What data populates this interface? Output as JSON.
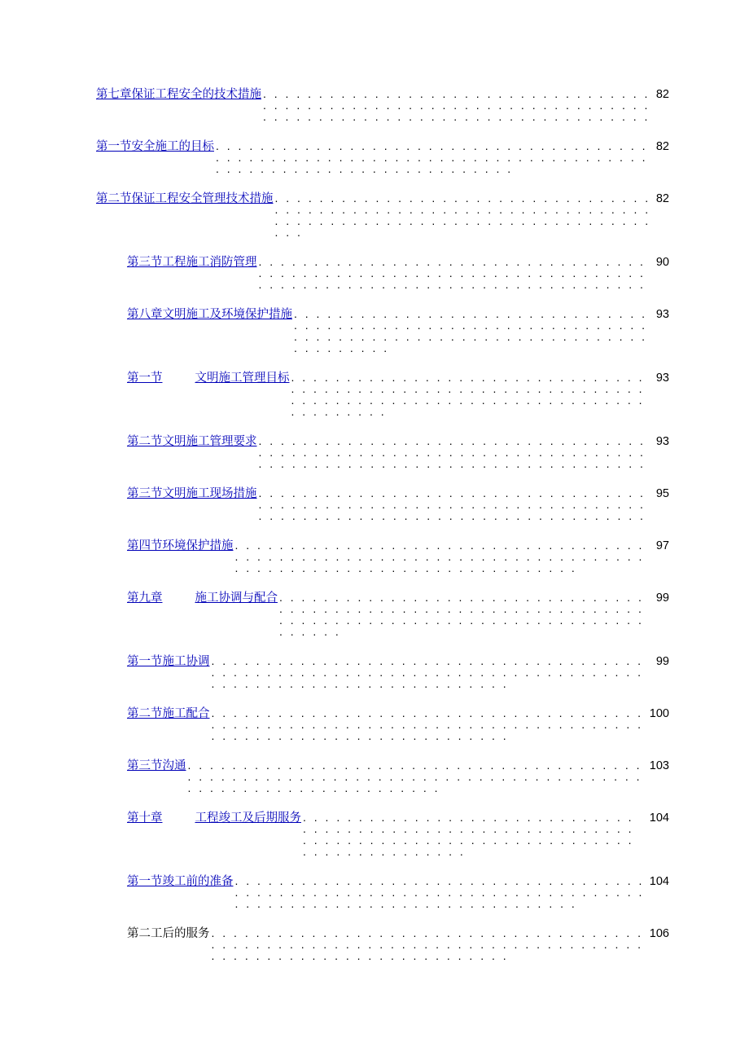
{
  "toc": [
    {
      "indent": 0,
      "link": true,
      "label": "第七章保证工程安全的技术措施",
      "page": "82"
    },
    {
      "indent": 0,
      "link": true,
      "label": "第一节安全施工的目标",
      "page": "82"
    },
    {
      "indent": 0,
      "link": true,
      "label": "第二节保证工程安全管理技术措施",
      "page": "82"
    },
    {
      "indent": 1,
      "link": true,
      "label": "第三节工程施工消防管理",
      "page": "90"
    },
    {
      "indent": 1,
      "link": true,
      "label": "第八章文明施工及环境保护措施",
      "page": "93"
    },
    {
      "indent": 1,
      "link": true,
      "labelParts": [
        "第一节",
        "文明施工管理目标"
      ],
      "page": "93"
    },
    {
      "indent": 1,
      "link": true,
      "label": "第二节文明施工管理要求",
      "page": "93"
    },
    {
      "indent": 1,
      "link": true,
      "label": "第三节文明施工现场措施",
      "page": "95"
    },
    {
      "indent": 1,
      "link": true,
      "label": "第四节环境保护措施",
      "page": "97"
    },
    {
      "indent": 1,
      "link": true,
      "labelParts": [
        "第九章",
        "施工协调与配合"
      ],
      "page": "99"
    },
    {
      "indent": 1,
      "link": true,
      "label": "第一节施工协调",
      "page": "99"
    },
    {
      "indent": 1,
      "link": true,
      "label": "第二节施工配合",
      "page": "100"
    },
    {
      "indent": 1,
      "link": true,
      "label": "第三节沟通",
      "page": "103"
    },
    {
      "indent": 1,
      "link": true,
      "labelParts": [
        "第十章",
        "工程竣工及后期服务"
      ],
      "page": "104"
    },
    {
      "indent": 1,
      "link": true,
      "label": "第一节竣工前的准备",
      "page": "104"
    },
    {
      "indent": 1,
      "link": false,
      "label": "第二工后的服务",
      "page": "106"
    }
  ]
}
